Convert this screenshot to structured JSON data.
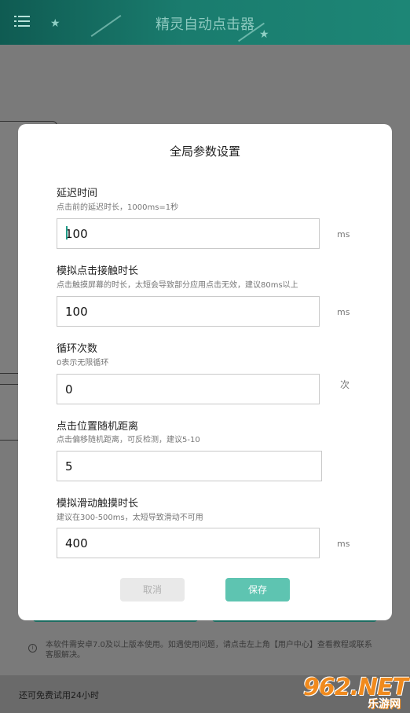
{
  "app": {
    "title": "精灵自动点击器",
    "menu_icon": "menu-icon",
    "colors": {
      "app_bar": "#1a7c6e",
      "accent": "#5ec4b1"
    }
  },
  "dialog": {
    "title": "全局参数设置",
    "fields": [
      {
        "label": "延迟时间",
        "hint": "点击前的延迟时长，1000ms=1秒",
        "value": "100",
        "unit": "ms"
      },
      {
        "label": "模拟点击接触时长",
        "hint": "点击触摸屏幕的时长，太短会导致部分应用点击无效，建议80ms以上",
        "value": "100",
        "unit": "ms"
      },
      {
        "label": "循环次数",
        "hint": "0表示无限循环",
        "value": "0",
        "unit": "次"
      },
      {
        "label": "点击位置随机距离",
        "hint": "点击偏移随机距离，可反检测，建议5-10",
        "value": "5",
        "unit": ""
      },
      {
        "label": "模拟滑动触摸时长",
        "hint": "建议在300-500ms，太短导致滑动不可用",
        "value": "400",
        "unit": "ms"
      }
    ],
    "cancel_label": "取消",
    "save_label": "保存"
  },
  "notice": {
    "text": "本软件需安卓7.0及以上版本使用。如遇使用问题，请点击左上角【用户中心】查看教程或联系客服解决。"
  },
  "footer": {
    "trial_text": "还可免费试用24小时"
  },
  "watermark": {
    "brand": "962.NET",
    "sub": "乐游网"
  }
}
